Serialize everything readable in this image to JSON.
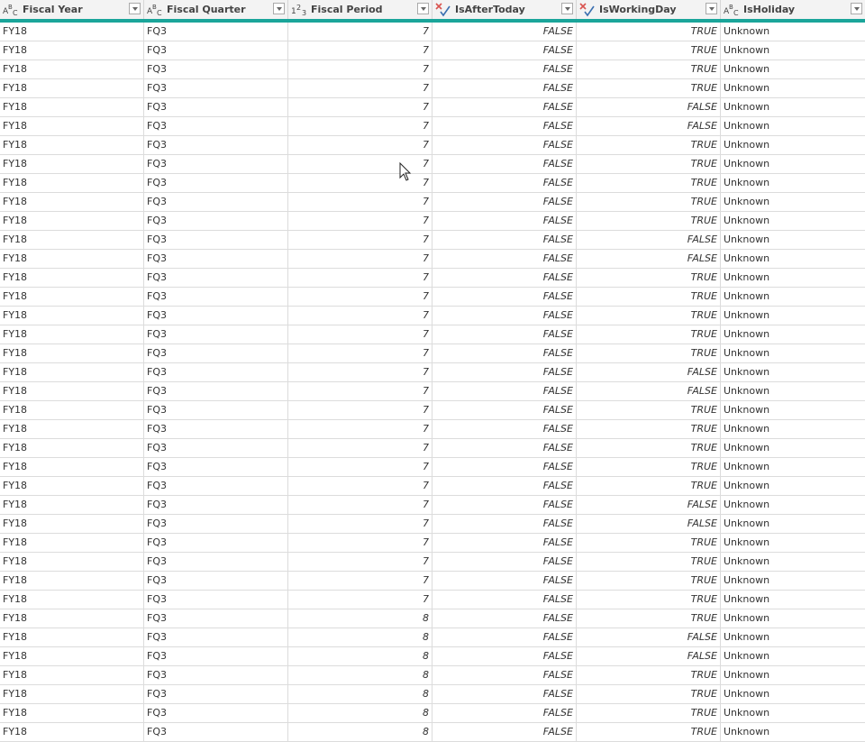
{
  "columns": [
    {
      "label": "Fiscal Year",
      "type_icon": "text-type-icon",
      "type_glyph": "ABC"
    },
    {
      "label": "Fiscal Quarter",
      "type_icon": "text-type-icon",
      "type_glyph": "ABC"
    },
    {
      "label": "Fiscal Period",
      "type_icon": "number-type-icon",
      "type_glyph": "123"
    },
    {
      "label": "IsAfterToday",
      "type_icon": "logical-type-icon",
      "type_glyph": "✗✓"
    },
    {
      "label": "IsWorkingDay",
      "type_icon": "logical-type-icon",
      "type_glyph": "✗✓"
    },
    {
      "label": "IsHoliday",
      "type_icon": "text-type-icon",
      "type_glyph": "ABC"
    }
  ],
  "colors": {
    "accent": "#1aa59a",
    "header_bg": "#f3f3f3",
    "grid_line": "#dcdcdc",
    "logical_x": "#d9534f",
    "logical_check": "#3a6fb0"
  },
  "rows": [
    [
      "FY18",
      "FQ3",
      "7",
      "FALSE",
      "TRUE",
      "Unknown"
    ],
    [
      "FY18",
      "FQ3",
      "7",
      "FALSE",
      "TRUE",
      "Unknown"
    ],
    [
      "FY18",
      "FQ3",
      "7",
      "FALSE",
      "TRUE",
      "Unknown"
    ],
    [
      "FY18",
      "FQ3",
      "7",
      "FALSE",
      "TRUE",
      "Unknown"
    ],
    [
      "FY18",
      "FQ3",
      "7",
      "FALSE",
      "FALSE",
      "Unknown"
    ],
    [
      "FY18",
      "FQ3",
      "7",
      "FALSE",
      "FALSE",
      "Unknown"
    ],
    [
      "FY18",
      "FQ3",
      "7",
      "FALSE",
      "TRUE",
      "Unknown"
    ],
    [
      "FY18",
      "FQ3",
      "7",
      "FALSE",
      "TRUE",
      "Unknown"
    ],
    [
      "FY18",
      "FQ3",
      "7",
      "FALSE",
      "TRUE",
      "Unknown"
    ],
    [
      "FY18",
      "FQ3",
      "7",
      "FALSE",
      "TRUE",
      "Unknown"
    ],
    [
      "FY18",
      "FQ3",
      "7",
      "FALSE",
      "TRUE",
      "Unknown"
    ],
    [
      "FY18",
      "FQ3",
      "7",
      "FALSE",
      "FALSE",
      "Unknown"
    ],
    [
      "FY18",
      "FQ3",
      "7",
      "FALSE",
      "FALSE",
      "Unknown"
    ],
    [
      "FY18",
      "FQ3",
      "7",
      "FALSE",
      "TRUE",
      "Unknown"
    ],
    [
      "FY18",
      "FQ3",
      "7",
      "FALSE",
      "TRUE",
      "Unknown"
    ],
    [
      "FY18",
      "FQ3",
      "7",
      "FALSE",
      "TRUE",
      "Unknown"
    ],
    [
      "FY18",
      "FQ3",
      "7",
      "FALSE",
      "TRUE",
      "Unknown"
    ],
    [
      "FY18",
      "FQ3",
      "7",
      "FALSE",
      "TRUE",
      "Unknown"
    ],
    [
      "FY18",
      "FQ3",
      "7",
      "FALSE",
      "FALSE",
      "Unknown"
    ],
    [
      "FY18",
      "FQ3",
      "7",
      "FALSE",
      "FALSE",
      "Unknown"
    ],
    [
      "FY18",
      "FQ3",
      "7",
      "FALSE",
      "TRUE",
      "Unknown"
    ],
    [
      "FY18",
      "FQ3",
      "7",
      "FALSE",
      "TRUE",
      "Unknown"
    ],
    [
      "FY18",
      "FQ3",
      "7",
      "FALSE",
      "TRUE",
      "Unknown"
    ],
    [
      "FY18",
      "FQ3",
      "7",
      "FALSE",
      "TRUE",
      "Unknown"
    ],
    [
      "FY18",
      "FQ3",
      "7",
      "FALSE",
      "TRUE",
      "Unknown"
    ],
    [
      "FY18",
      "FQ3",
      "7",
      "FALSE",
      "FALSE",
      "Unknown"
    ],
    [
      "FY18",
      "FQ3",
      "7",
      "FALSE",
      "FALSE",
      "Unknown"
    ],
    [
      "FY18",
      "FQ3",
      "7",
      "FALSE",
      "TRUE",
      "Unknown"
    ],
    [
      "FY18",
      "FQ3",
      "7",
      "FALSE",
      "TRUE",
      "Unknown"
    ],
    [
      "FY18",
      "FQ3",
      "7",
      "FALSE",
      "TRUE",
      "Unknown"
    ],
    [
      "FY18",
      "FQ3",
      "7",
      "FALSE",
      "TRUE",
      "Unknown"
    ],
    [
      "FY18",
      "FQ3",
      "8",
      "FALSE",
      "TRUE",
      "Unknown"
    ],
    [
      "FY18",
      "FQ3",
      "8",
      "FALSE",
      "FALSE",
      "Unknown"
    ],
    [
      "FY18",
      "FQ3",
      "8",
      "FALSE",
      "FALSE",
      "Unknown"
    ],
    [
      "FY18",
      "FQ3",
      "8",
      "FALSE",
      "TRUE",
      "Unknown"
    ],
    [
      "FY18",
      "FQ3",
      "8",
      "FALSE",
      "TRUE",
      "Unknown"
    ],
    [
      "FY18",
      "FQ3",
      "8",
      "FALSE",
      "TRUE",
      "Unknown"
    ],
    [
      "FY18",
      "FQ3",
      "8",
      "FALSE",
      "TRUE",
      "Unknown"
    ]
  ]
}
